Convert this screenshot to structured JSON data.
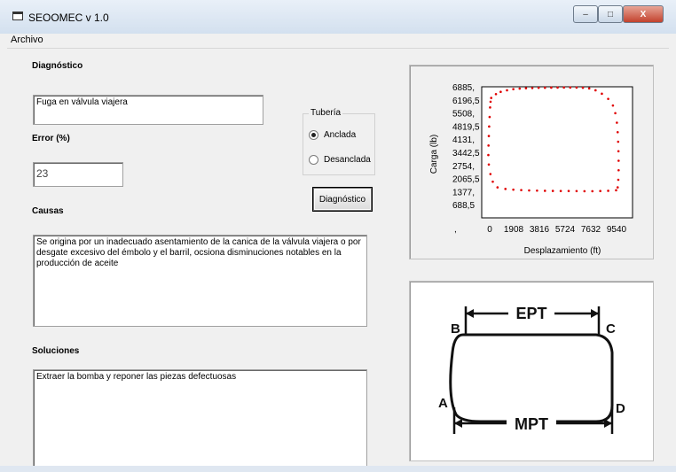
{
  "window": {
    "title": "SEOOMEC v 1.0",
    "minimize": "–",
    "maximize": "□",
    "close": "X"
  },
  "menu": {
    "file": "Archivo"
  },
  "form": {
    "diagnostico_label": "Diagnóstico",
    "diagnostico_value": "Fuga en válvula viajera",
    "error_label": "Error (%)",
    "error_value": "23",
    "causas_label": "Causas",
    "causas_value": "Se origina por un inadecuado asentamiento de la canica de la válvula viajera o por desgate excesivo del émbolo y el barril, ocsiona disminuciones notables en la producción de aceite",
    "soluciones_label": "Soluciones",
    "soluciones_value": "Extraer la bomba y reponer las piezas defectuosas",
    "tuberia": {
      "title": "Tubería",
      "options": [
        {
          "label": "Anclada",
          "selected": true
        },
        {
          "label": "Desanclada",
          "selected": false
        }
      ]
    },
    "diagnostico_button": "Diagnóstico"
  },
  "chart_data": {
    "type": "scatter",
    "xlabel": "Desplazamiento (ft)",
    "ylabel": "Carga (lb)",
    "x_ticks": [
      "0",
      "1908",
      "3816",
      "5724",
      "7632",
      "9540"
    ],
    "y_ticks": [
      "688,5",
      "1377,",
      "2065,5",
      "2754,",
      "3442,5",
      "4131,",
      "4819,5",
      "5508,",
      "6196,5",
      "6885,"
    ],
    "x_origin_label": ",",
    "xlim": [
      0,
      9540
    ],
    "ylim": [
      0,
      6885
    ],
    "series_color": "#e00000",
    "points_top": [
      [
        600,
        6300
      ],
      [
        900,
        6500
      ],
      [
        1200,
        6620
      ],
      [
        1600,
        6700
      ],
      [
        2000,
        6760
      ],
      [
        2400,
        6790
      ],
      [
        2800,
        6810
      ],
      [
        3200,
        6820
      ],
      [
        3600,
        6830
      ],
      [
        4000,
        6835
      ],
      [
        4400,
        6840
      ],
      [
        4800,
        6842
      ],
      [
        5200,
        6845
      ],
      [
        5600,
        6845
      ],
      [
        6000,
        6843
      ],
      [
        6400,
        6835
      ],
      [
        6800,
        6800
      ],
      [
        7200,
        6700
      ],
      [
        7600,
        6520
      ],
      [
        8000,
        6250
      ],
      [
        8300,
        5900
      ]
    ],
    "points_right": [
      [
        8450,
        5500
      ],
      [
        8550,
        5000
      ],
      [
        8600,
        4500
      ],
      [
        8630,
        4000
      ],
      [
        8650,
        3500
      ],
      [
        8660,
        3000
      ],
      [
        8660,
        2500
      ],
      [
        8640,
        2000
      ],
      [
        8600,
        1600
      ]
    ],
    "points_bottom": [
      [
        8500,
        1450
      ],
      [
        8000,
        1420
      ],
      [
        7500,
        1410
      ],
      [
        7000,
        1400
      ],
      [
        6500,
        1400
      ],
      [
        6000,
        1405
      ],
      [
        5500,
        1410
      ],
      [
        5000,
        1410
      ],
      [
        4500,
        1415
      ],
      [
        4000,
        1420
      ],
      [
        3500,
        1430
      ],
      [
        3000,
        1440
      ],
      [
        2500,
        1460
      ],
      [
        2000,
        1480
      ],
      [
        1500,
        1520
      ],
      [
        1000,
        1600
      ]
    ],
    "points_left": [
      [
        700,
        1900
      ],
      [
        550,
        2300
      ],
      [
        450,
        2800
      ],
      [
        420,
        3300
      ],
      [
        430,
        3800
      ],
      [
        450,
        4300
      ],
      [
        470,
        4800
      ],
      [
        500,
        5300
      ],
      [
        530,
        5800
      ],
      [
        560,
        6100
      ]
    ]
  },
  "diagram": {
    "labels": {
      "A": "A",
      "B": "B",
      "C": "C",
      "D": "D",
      "top": "EPT",
      "bottom": "MPT"
    }
  }
}
